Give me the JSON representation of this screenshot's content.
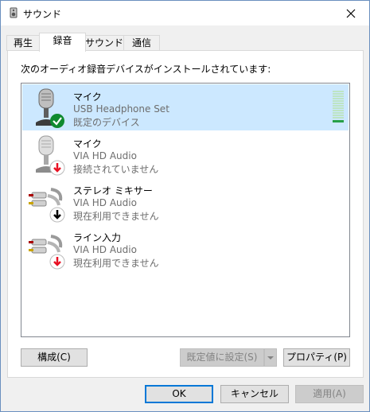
{
  "window": {
    "title": "サウンド"
  },
  "tabs": [
    {
      "label": "再生"
    },
    {
      "label": "録音"
    },
    {
      "label": "サウンド"
    },
    {
      "label": "通信"
    }
  ],
  "panel": {
    "heading": "次のオーディオ録音デバイスがインストールされています:"
  },
  "devices": [
    {
      "name": "マイク",
      "driver": "USB Headphone Set",
      "status": "既定のデバイス",
      "icon": "microphone-icon",
      "badge": "check-badge"
    },
    {
      "name": "マイク",
      "driver": "VIA HD Audio",
      "status": "接続されていません",
      "icon": "microphone-icon",
      "badge": "red-down-arrow-badge"
    },
    {
      "name": "ステレオ ミキサー",
      "driver": "VIA HD Audio",
      "status": "現在利用できません",
      "icon": "rca-cable-icon",
      "badge": "black-down-arrow-badge"
    },
    {
      "name": "ライン入力",
      "driver": "VIA HD Audio",
      "status": "現在利用できません",
      "icon": "rca-cable-icon",
      "badge": "red-down-arrow-badge"
    }
  ],
  "level_meter": {
    "level": 0.05
  },
  "buttons": {
    "configure": "構成(C)",
    "set_default": "既定値に設定(S)",
    "properties": "プロパティ(P)",
    "ok": "OK",
    "cancel": "キャンセル",
    "apply": "適用(A)"
  },
  "colors": {
    "selection": "#cce8ff",
    "accent": "#0078d7",
    "check": "#0f8a2f",
    "arrow_red": "#e81123"
  }
}
